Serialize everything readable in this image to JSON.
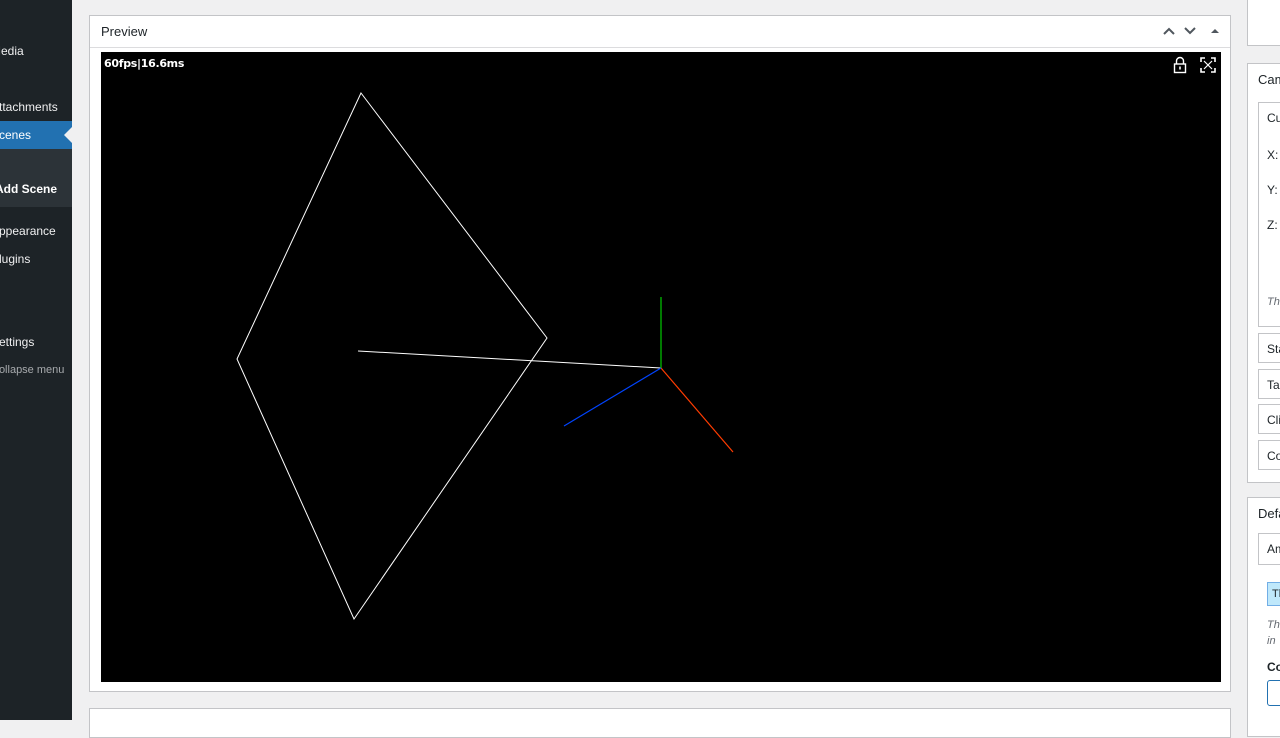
{
  "sidebar": {
    "items": [
      {
        "label": "Media"
      },
      {
        "label": "Attachments"
      },
      {
        "label": "Scenes"
      },
      {
        "label": "Appearance"
      },
      {
        "label": "Plugins"
      },
      {
        "label": "Settings"
      },
      {
        "label": "Collapse menu"
      }
    ],
    "submenu": [
      {
        "label": "Add Scene"
      }
    ]
  },
  "preview": {
    "title": "Preview",
    "stats": "60fps|16.6ms",
    "move_up_icon": "chevron-up-icon",
    "move_down_icon": "chevron-down-icon",
    "toggle_icon": "triangle-up-icon",
    "lock_icon": "lock-icon",
    "fullscreen_icon": "fullscreen-icon",
    "axis_colors": {
      "x": "#ff3c00",
      "y": "#00cc00",
      "z": "#0044ff"
    },
    "line_color": "#ffffff"
  },
  "camera": {
    "title": "Camera",
    "current_label": "Current",
    "x_label": "X:",
    "y_label": "Y:",
    "z_label": "Z:",
    "hint": "The",
    "sections": [
      {
        "label": "Start"
      },
      {
        "label": "Target"
      },
      {
        "label": "Clip"
      },
      {
        "label": "Controls"
      }
    ]
  },
  "defaults": {
    "title": "Defaults",
    "ambient_label": "Ambient",
    "chip_text": "Th",
    "hint_line1": "Th",
    "hint_line2": "in",
    "color_label": "Co"
  }
}
